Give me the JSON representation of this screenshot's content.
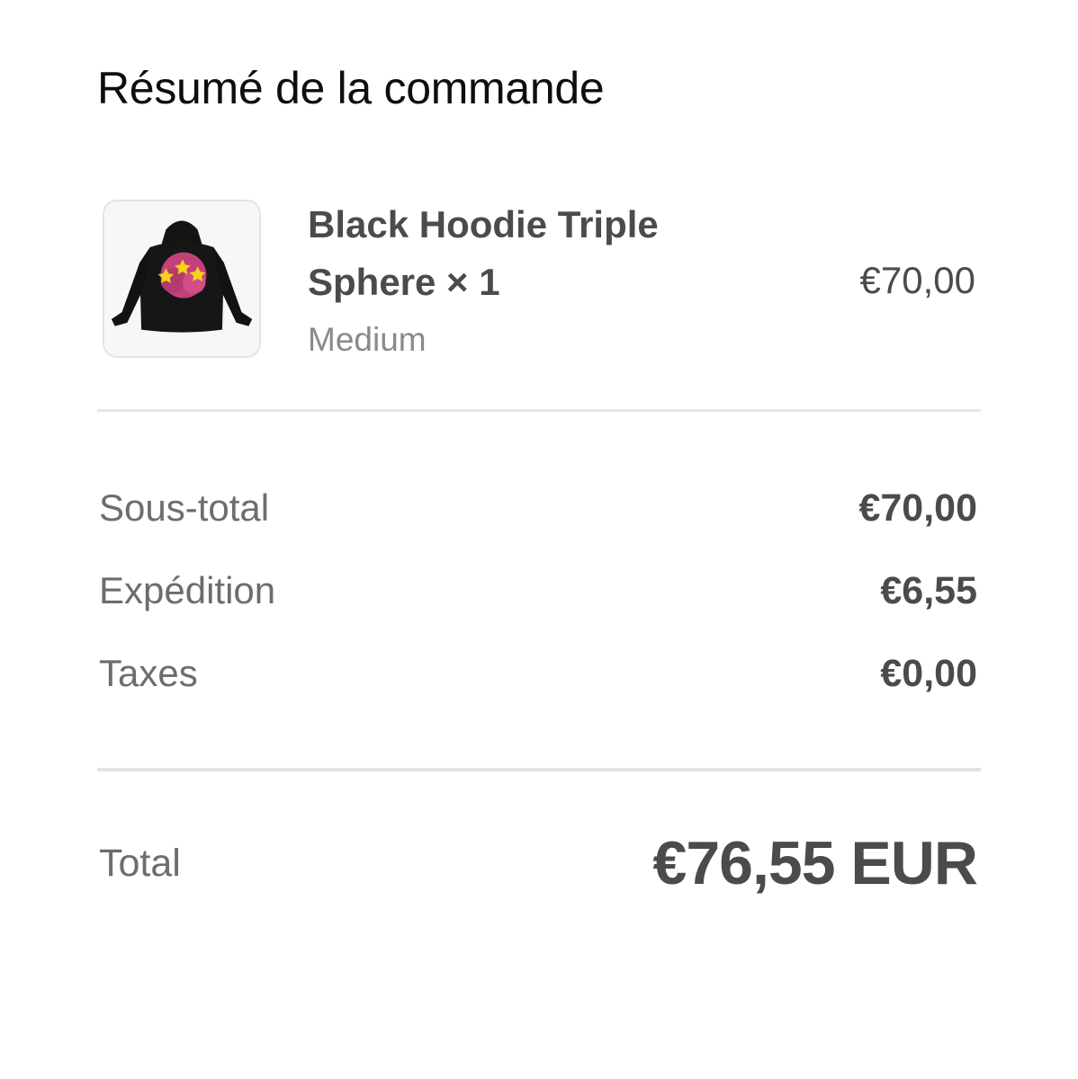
{
  "summary": {
    "title": "Résumé de la commande"
  },
  "product": {
    "name": "Black Hoodie Triple Sphere × 1",
    "variant": "Medium",
    "price": "€70,00",
    "image_icon": "hoodie-product-image"
  },
  "totals": {
    "subtotal_label": "Sous-total",
    "subtotal_value": "€70,00",
    "shipping_label": "Expédition",
    "shipping_value": "€6,55",
    "taxes_label": "Taxes",
    "taxes_value": "€0,00",
    "total_label": "Total",
    "total_value": "€76,55 EUR"
  },
  "colors": {
    "text_dark": "#4b4b4b",
    "text_muted": "#8a8a8a",
    "divider": "#e6e6e6",
    "hoodie": "#141414",
    "graphic_pink": "#c4407a",
    "graphic_star": "#f5d21c"
  }
}
